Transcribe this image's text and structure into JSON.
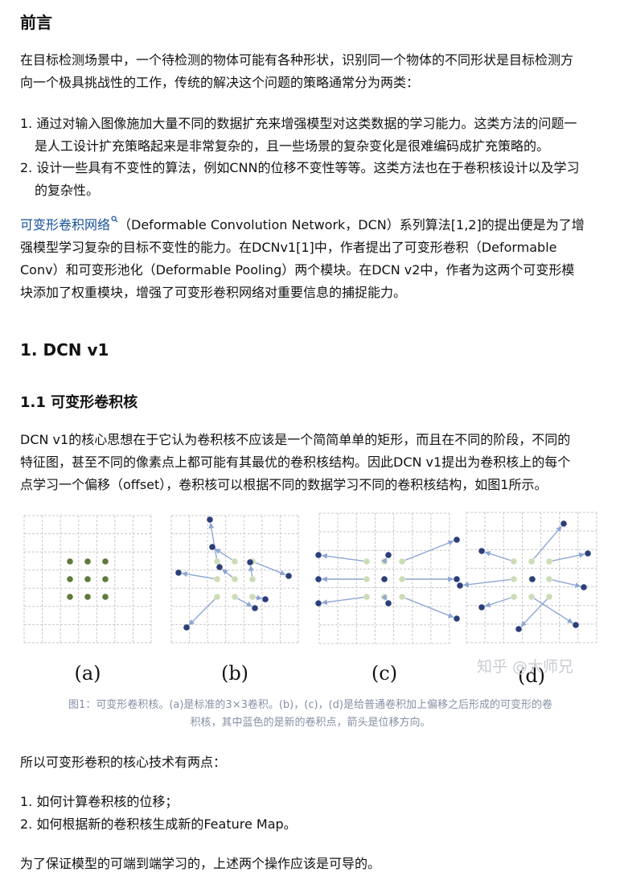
{
  "foreword": {
    "heading": "前言",
    "intro": [
      "在目标检测场景中，一个待检测的物体可能有各种形状，识别同一个物体的不同形状是目标检测方",
      "向一个极具挑战性的工作，传统的解决这个问题的策略通常分为两类："
    ],
    "items": [
      [
        "1. 通过对输入图像施加大量不同的数据扩充来增强模型对这类数据的学习能力。这类方法的问题一",
        "是人工设计扩充策略起来是非常复杂的，且一些场景的复杂变化是很难编码成扩充策略的。"
      ],
      [
        "2. 设计一些具有不变性的算法，例如CNN的位移不变性等等。这类方法也在于卷积核设计以及学习",
        "的复杂性。"
      ]
    ],
    "dcn_link": "可变形卷积网络",
    "dcn_para": [
      "（Deformable Convolution Network，DCN）系列算法[1,2]的提出便是为了增",
      "强模型学习复杂的目标不变性的能力。在DCNv1[1]中，作者提出了可变形卷积（Deformable",
      "Conv）和可变形池化（Deformable Pooling）两个模块。在DCN v2中，作者为这两个可变形模",
      "块添加了权重模块，增强了可变形卷积网络对重要信息的捕捉能力。"
    ]
  },
  "section1": {
    "heading": "1. DCN v1",
    "sub_heading": "1.1 可变形卷积核",
    "para": [
      "DCN v1的核心思想在于它认为卷积核不应该是一个简简单单的矩形，而且在不同的阶段，不同的",
      "特征图，甚至不同的像素点上都可能有其最优的卷积核结构。因此DCN v1提出为卷积核上的每个",
      "点学习一个偏移（offset），卷积核可以根据不同的数据学习不同的卷积核结构，如图1所示。"
    ]
  },
  "figure": {
    "panel_labels": [
      "(a)",
      "(b)",
      "(c)",
      "(d)"
    ],
    "watermark": "知乎 @大师兄",
    "caption": [
      "图1：可变形卷积核。(a)是标准的3×3卷积。(b)，(c)，(d)是给普通卷积加上偏移之后形成的可变形的卷",
      "积核，其中蓝色的是新的卷积点，箭头是位移方向。"
    ],
    "colors": {
      "standard_point": "#5f7a3c",
      "original_point": "#cddcb6",
      "new_point": "#2c3e7a",
      "arrow": "#8ea6d4",
      "grid": "#c8c8c8"
    }
  },
  "outro": {
    "lead": "所以可变形卷积的核心技术有两点：",
    "points": [
      "1. 如何计算卷积核的位移；",
      "2. 如何根据新的卷积核生成新的Feature Map。"
    ],
    "closing": "为了保证模型的可端到端学习的，上述两个操作应该是可导的。"
  }
}
